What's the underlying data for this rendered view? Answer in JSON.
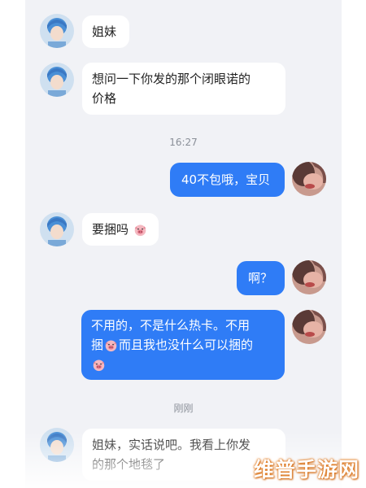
{
  "chat": {
    "messages": [
      {
        "sender": "other",
        "text": "姐妹"
      },
      {
        "sender": "other",
        "line1": "想问一下你发的那个闭眼诺的",
        "line2": "价格"
      },
      {
        "sender": "me",
        "text": "40不包哦，宝贝"
      },
      {
        "sender": "other",
        "text": "要捆吗",
        "emoji": "pig-face-emoji"
      },
      {
        "sender": "me",
        "text": "啊？"
      },
      {
        "sender": "me",
        "line1": "不用的，不是什么热卡。不用",
        "line2_a": "捆",
        "line2_b": "而且我也没什么可以捆的",
        "emoji": "pig-face-emoji"
      },
      {
        "sender": "other",
        "line1": "姐妹，实话说吧。我看上你发",
        "line2": "的那个地毯了"
      }
    ],
    "timestamps": [
      "16:27",
      "刚刚"
    ],
    "colors": {
      "outgoing_bubble": "#2f7cf6",
      "incoming_bubble": "#ffffff",
      "background": "#f1f2f6"
    }
  },
  "watermark": {
    "text": "维普手游网"
  }
}
